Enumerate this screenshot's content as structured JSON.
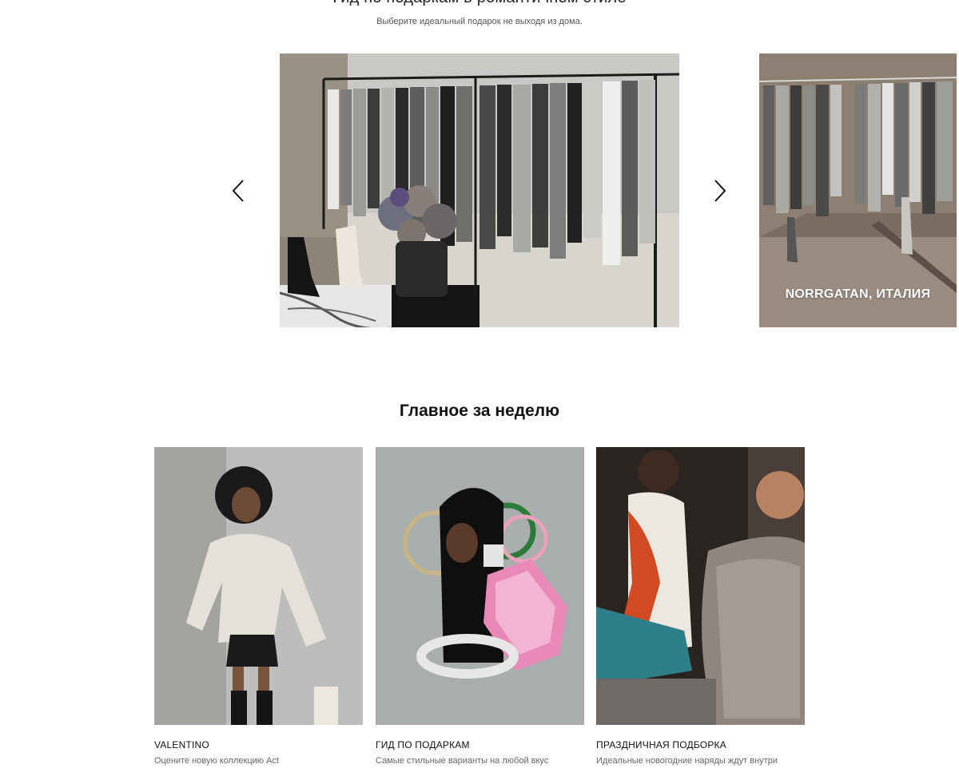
{
  "gift_guide": {
    "title": "Гид по подаркам в романтичном стиле",
    "subtitle": "Выберите идеальный подарок не выходя из дома."
  },
  "carousel": {
    "slides": [
      {
        "caption": ""
      },
      {
        "caption": "NORRGATAN, ИТАЛИЯ"
      }
    ],
    "prev_icon": "chevron-left-icon",
    "next_icon": "chevron-right-icon"
  },
  "weekly": {
    "title": "Главное за неделю",
    "cards": [
      {
        "label": "VALENTINO",
        "description": "Оцените новую коллекцию Act"
      },
      {
        "label": "ГИД ПО ПОДАРКАМ",
        "description": "Самые стильные варианты на любой вкус"
      },
      {
        "label": "ПРАЗДНИЧНАЯ ПОДБОРКА",
        "description": "Идеальные новогодние наряды ждут внутри"
      }
    ]
  }
}
